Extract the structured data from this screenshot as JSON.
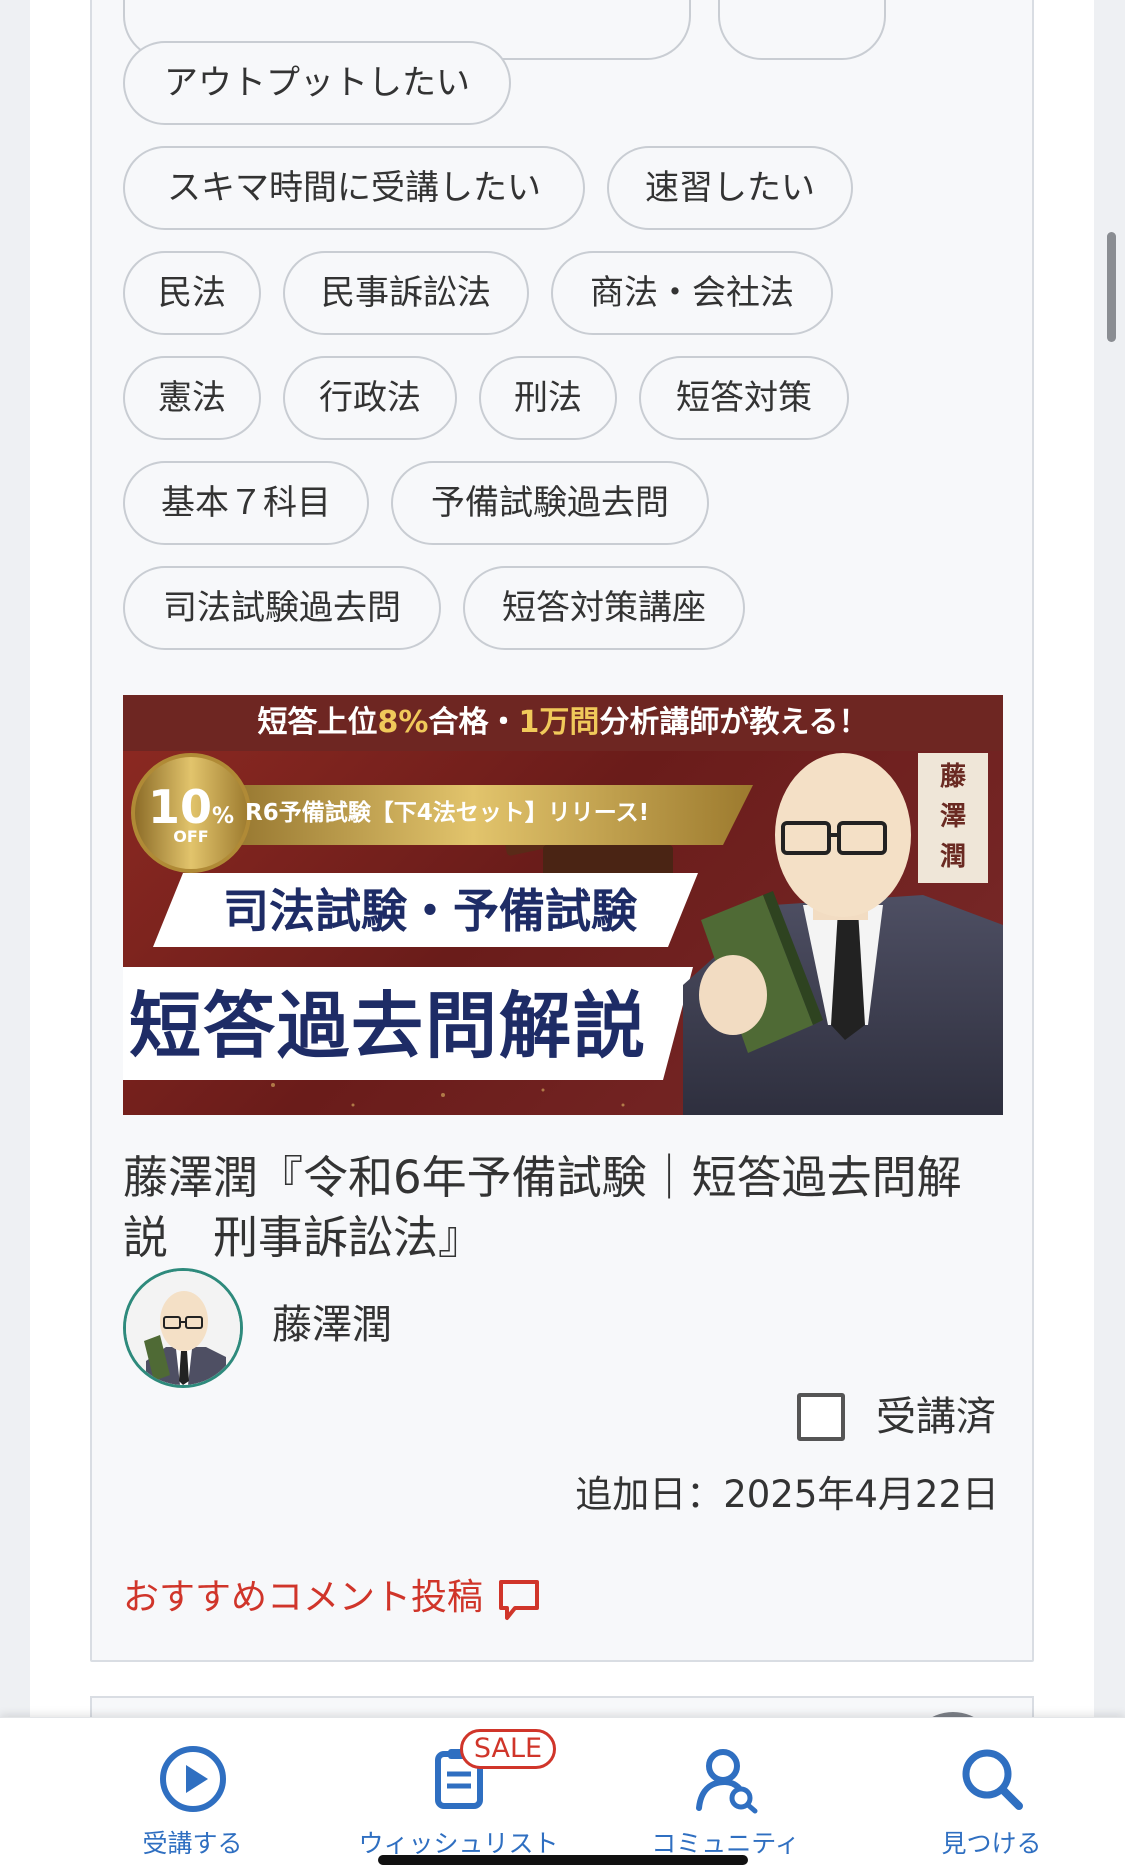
{
  "tags": [
    {
      "label": ""
    },
    {
      "label": ""
    },
    {
      "label": "アウトプットしたい"
    },
    {
      "label": "スキマ時間に受講したい"
    },
    {
      "label": "速習したい"
    },
    {
      "label": "民法"
    },
    {
      "label": "民事訴訟法"
    },
    {
      "label": "商法・会社法"
    },
    {
      "label": "憲法"
    },
    {
      "label": "行政法"
    },
    {
      "label": "刑法"
    },
    {
      "label": "短答対策"
    },
    {
      "label": "基本７科目"
    },
    {
      "label": "予備試験過去問"
    },
    {
      "label": "司法試験過去問"
    },
    {
      "label": "短答対策講座"
    }
  ],
  "banner": {
    "headline_a": "短答上位",
    "headline_b": "8%",
    "headline_c": "合格・",
    "headline_d": "1万問",
    "headline_e": "分析講師が教える！",
    "discount_num": "10",
    "discount_pct": "%",
    "discount_off": "OFF",
    "release": "R6予備試験【下4法セット】リリース!",
    "subtitle": "司法試験・予備試験",
    "main": "短答過去問解説",
    "vertical_name": "藤澤潤"
  },
  "course": {
    "title": "藤澤潤『令和6年予備試験｜短答過去問解説　刑事訴訟法』",
    "author": "藤澤潤",
    "completed_label": "受講済",
    "added_date": "追加日：2025年4月22日",
    "recommend_label": "おすすめコメント投稿"
  },
  "tabbar": {
    "items": [
      {
        "label": "受講する",
        "icon": "play-circle-icon"
      },
      {
        "label": "ウィッシュリスト",
        "icon": "wishlist-icon"
      },
      {
        "label": "コミュニティ",
        "icon": "community-icon"
      },
      {
        "label": "見つける",
        "icon": "search-icon"
      }
    ],
    "sale_badge": "SALE"
  },
  "colors": {
    "accent_blue": "#2f6fc1",
    "sale_red": "#d0352a",
    "banner_red": "#8e2a22",
    "banner_gold": "#c9a54a"
  }
}
